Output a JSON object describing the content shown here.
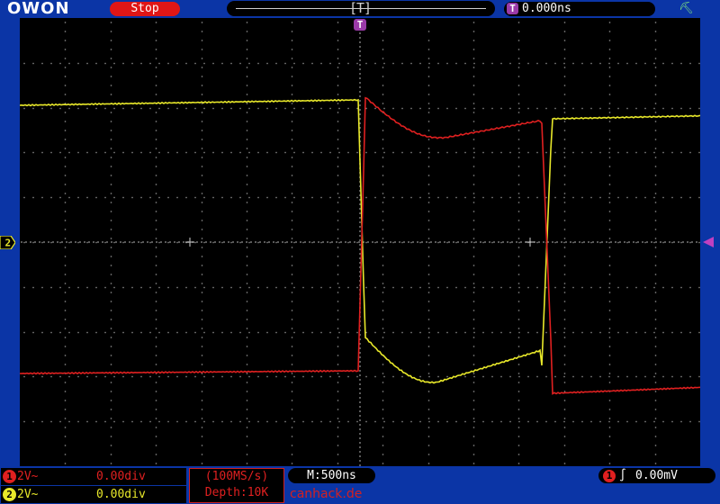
{
  "header": {
    "logo": "OWON",
    "status": "Stop",
    "mem_bracket": "[T]",
    "trigger_time_badge": "T",
    "trigger_time": "0.000ns",
    "usb_icon": "usb-icon"
  },
  "screen_marker": "T",
  "channels": [
    {
      "num": "1",
      "coupling": "2V~",
      "offset": "0.00div",
      "color": "#e02020"
    },
    {
      "num": "2",
      "coupling": "2V~",
      "offset": "0.00div",
      "color": "#e8e82a"
    }
  ],
  "ch2_marker_label": "2",
  "acquisition": {
    "rate": "(100MS/s)",
    "depth": "Depth:10K"
  },
  "timebase": "M:500ns",
  "watermark": "canhack.de",
  "trigger": {
    "source": "1",
    "edge": "∫",
    "level": "0.00mV"
  },
  "colors": {
    "grid": "#8c8c8c",
    "ch1": "#e02020",
    "ch2": "#e8e82a",
    "trigger": "#c040c0",
    "frame": "#0b35a6"
  }
}
